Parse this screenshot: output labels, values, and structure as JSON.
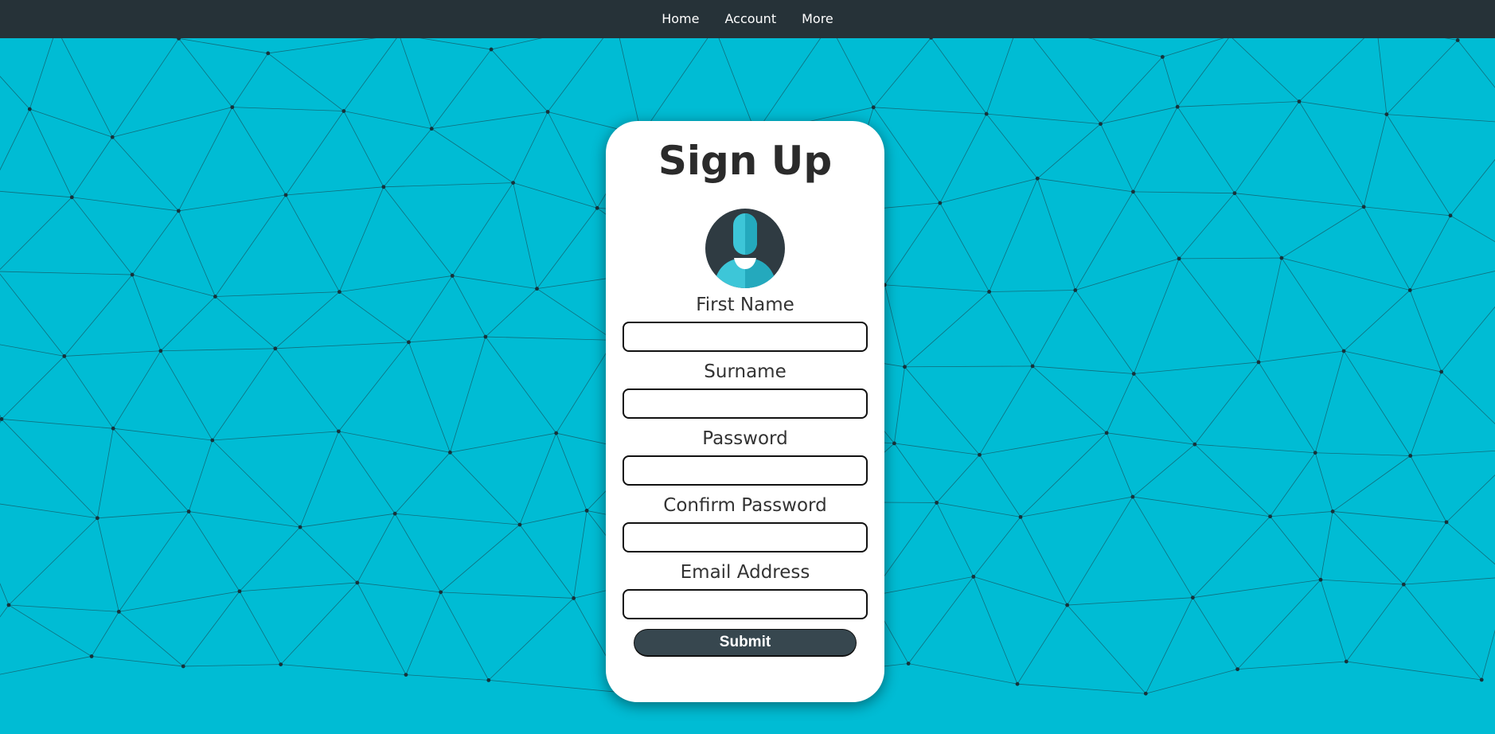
{
  "nav": {
    "items": [
      {
        "label": "Home"
      },
      {
        "label": "Account"
      },
      {
        "label": "More"
      }
    ],
    "background_color": "#263238"
  },
  "background": {
    "color": "#00bcd4",
    "pattern": "triangle-mesh"
  },
  "form": {
    "title": "Sign Up",
    "avatar_icon": "user-avatar-icon",
    "fields": [
      {
        "label": "First Name",
        "value": ""
      },
      {
        "label": "Surname",
        "value": ""
      },
      {
        "label": "Password",
        "value": ""
      },
      {
        "label": "Confirm Password",
        "value": ""
      },
      {
        "label": "Email Address",
        "value": ""
      }
    ],
    "submit_label": "Submit",
    "submit_color": "#37474f"
  }
}
